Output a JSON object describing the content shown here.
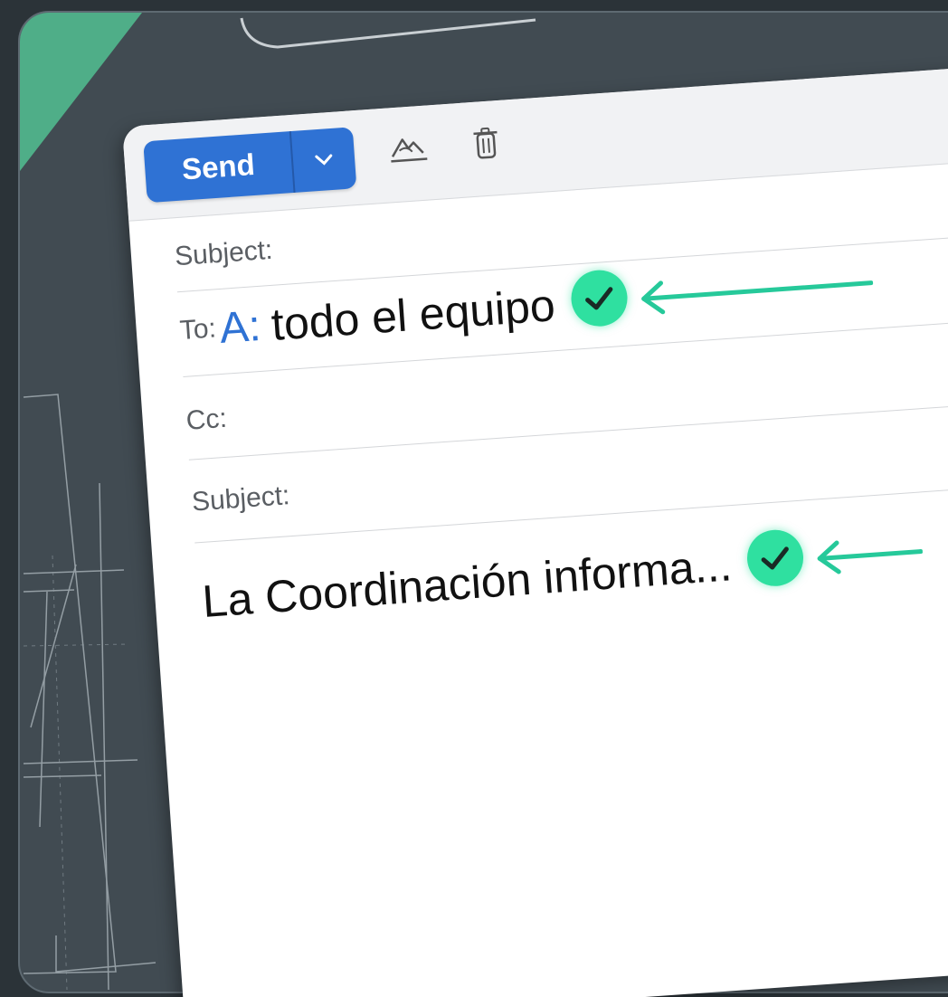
{
  "colors": {
    "accent": "#2f72d4",
    "check": "#2fe0a0",
    "arrow": "#26c99a",
    "board": "#414b52",
    "corner": "#4fae88"
  },
  "toolbar": {
    "send_label": "Send",
    "dropdown_icon": "chevron-down-icon",
    "format_icon": "signature-icon",
    "trash_icon": "trash-icon"
  },
  "fields": {
    "subject_top_label": "Subject:",
    "to_label": "To:",
    "to_prefix": "A:",
    "to_value": "todo el equipo",
    "cc_label": "Cc:",
    "subject_label": "Subject:"
  },
  "body": {
    "text": "La Coordinación informa..."
  }
}
